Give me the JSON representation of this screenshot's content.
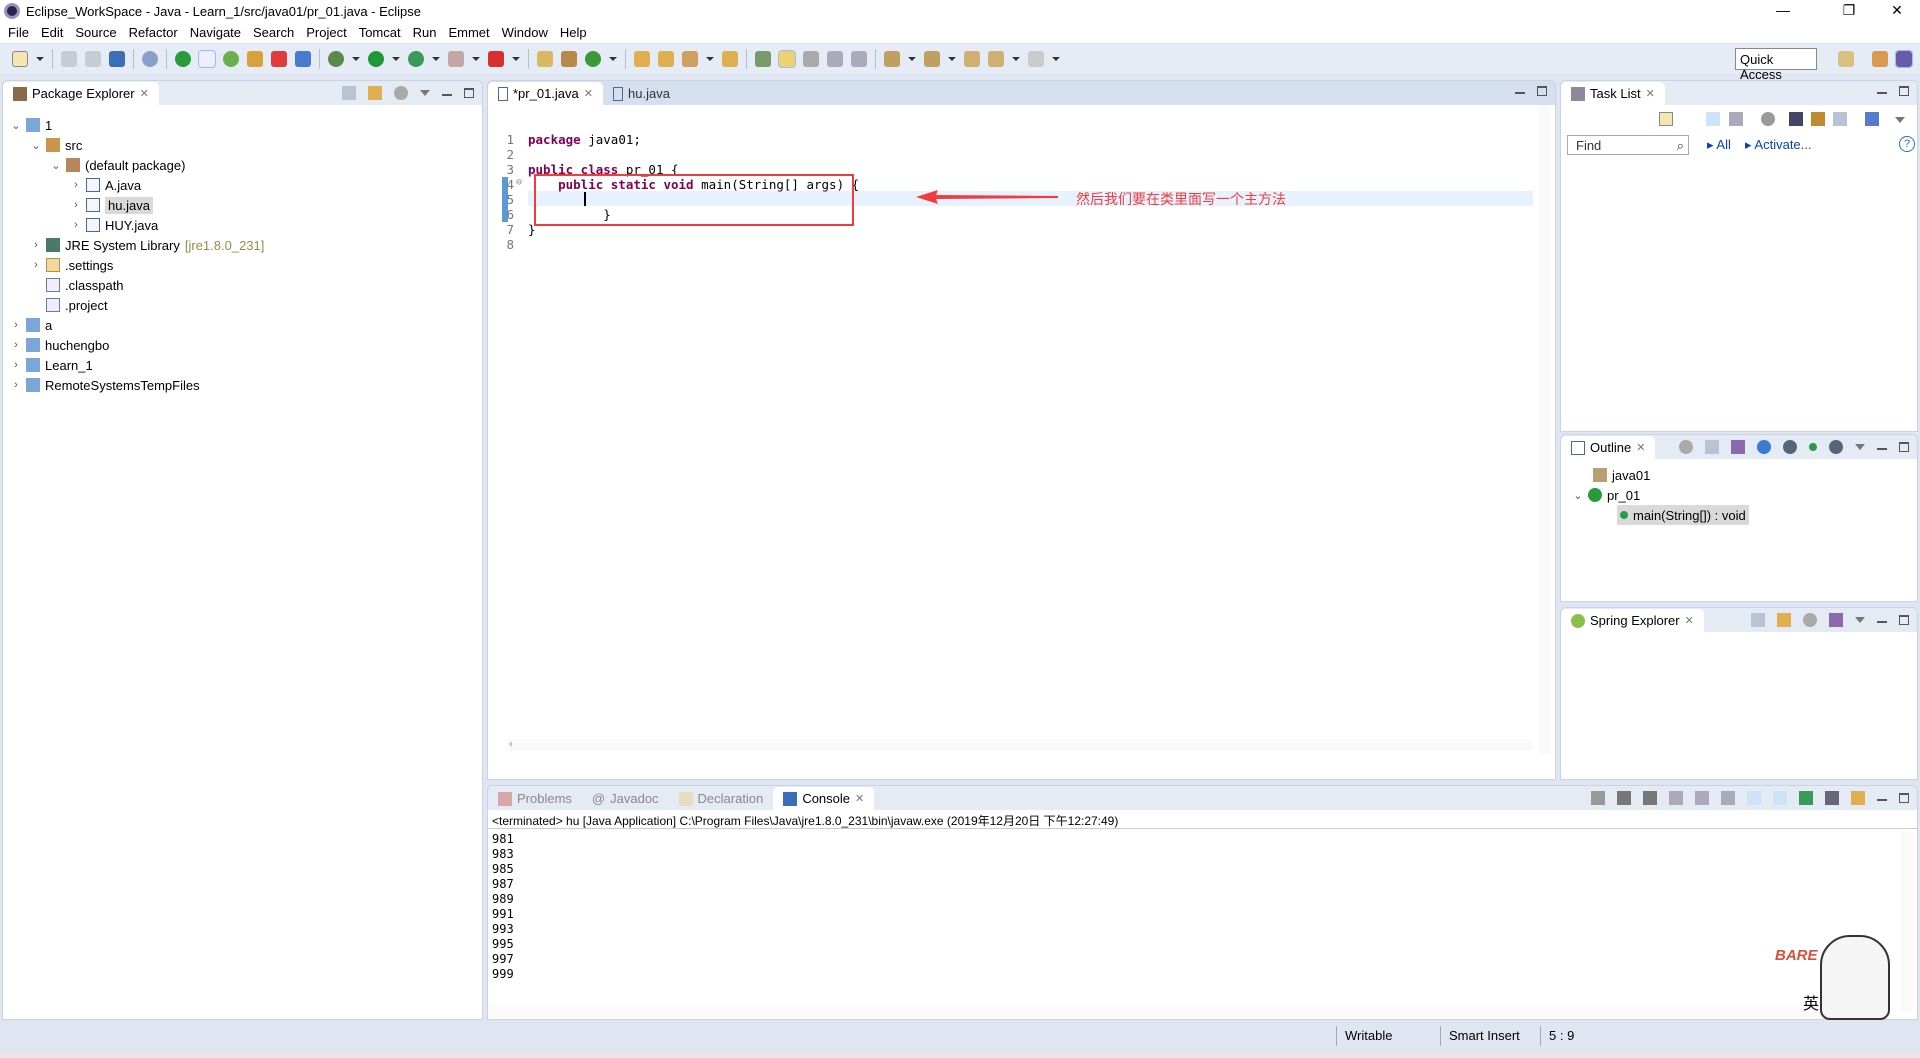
{
  "window": {
    "title": "Eclipse_WorkSpace - Java - Learn_1/src/java01/pr_01.java - Eclipse"
  },
  "menu": [
    "File",
    "Edit",
    "Source",
    "Refactor",
    "Navigate",
    "Search",
    "Project",
    "Tomcat",
    "Run",
    "Emmet",
    "Window",
    "Help"
  ],
  "toolbar": {
    "quick_access": "Quick Access"
  },
  "package_explorer": {
    "title": "Package Explorer",
    "items": [
      {
        "label": "1"
      },
      {
        "label": "src"
      },
      {
        "label": "(default package)"
      },
      {
        "label": "A.java"
      },
      {
        "label": "hu.java"
      },
      {
        "label": "HUY.java"
      },
      {
        "label": "JRE System Library",
        "suffix": "[jre1.8.0_231]"
      },
      {
        "label": ".settings"
      },
      {
        "label": ".classpath"
      },
      {
        "label": ".project"
      },
      {
        "label": "a"
      },
      {
        "label": "huchengbo"
      },
      {
        "label": "Learn_1"
      },
      {
        "label": "RemoteSystemsTempFiles"
      }
    ]
  },
  "editor": {
    "tabs": [
      {
        "label": "*pr_01.java"
      },
      {
        "label": "hu.java"
      }
    ],
    "lines": [
      {
        "n": "1",
        "kw": "package",
        "rest": " java01;"
      },
      {
        "n": "2",
        "kw": "",
        "rest": ""
      },
      {
        "n": "3",
        "kw": "public class",
        "rest": " pr_01 {"
      },
      {
        "n": "4",
        "kw": "    public static void",
        "rest": " main(String[] args) {"
      },
      {
        "n": "5",
        "kw": "",
        "rest": ""
      },
      {
        "n": "6",
        "kw": "",
        "rest": "          }"
      },
      {
        "n": "7",
        "kw": "",
        "rest": "}"
      },
      {
        "n": "8",
        "kw": "",
        "rest": ""
      }
    ],
    "annotation": "然后我们要在类里面写一个主方法",
    "annotation_color": "#f03c3c"
  },
  "task_list": {
    "title": "Task List",
    "find_placeholder": "Find",
    "all": "All",
    "activate": "Activate..."
  },
  "outline": {
    "title": "Outline",
    "items": [
      {
        "label": "java01"
      },
      {
        "label": "pr_01"
      },
      {
        "label": "main(String[]) : void"
      }
    ]
  },
  "spring_explorer": {
    "title": "Spring Explorer"
  },
  "bottom": {
    "tabs": [
      {
        "label": "Problems"
      },
      {
        "label": "Javadoc"
      },
      {
        "label": "Declaration"
      },
      {
        "label": "Console"
      }
    ],
    "header": "<terminated> hu [Java Application] C:\\Program Files\\Java\\jre1.8.0_231\\bin\\javaw.exe (2019年12月20日 下午12:27:49)",
    "output": [
      "981",
      "983",
      "985",
      "987",
      "989",
      "991",
      "993",
      "995",
      "997",
      "999"
    ]
  },
  "status": {
    "writable": "Writable",
    "insert_mode": "Smart Insert",
    "position": "5 : 9"
  },
  "ime": {
    "label": "英"
  }
}
